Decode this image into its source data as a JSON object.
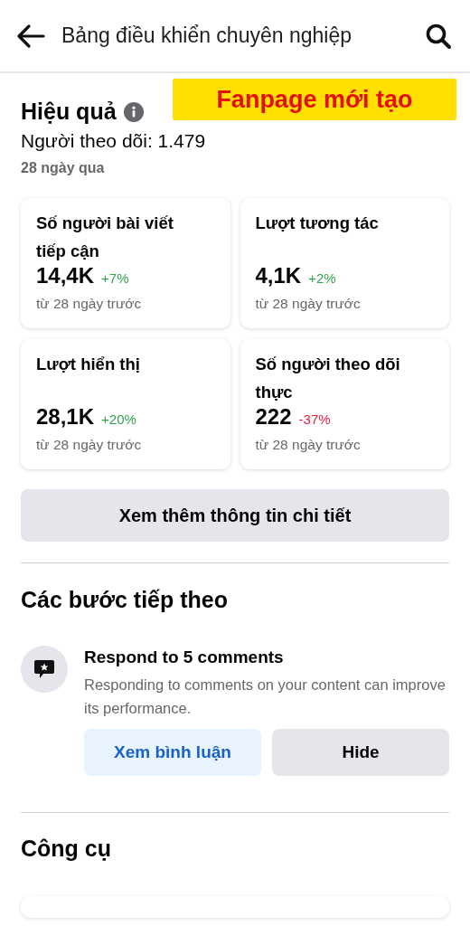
{
  "header": {
    "title": "Bảng điều khiển chuyên nghiệp"
  },
  "banner": {
    "text": "Fanpage mới tạo"
  },
  "performance": {
    "title": "Hiệu quả",
    "followers": "Người theo dõi: 1.479",
    "period": "28 ngày qua",
    "metrics": [
      {
        "label": "Số người bài viết tiếp cận",
        "value": "14,4K",
        "change": "+7%",
        "kind": "increase",
        "note": "từ 28 ngày trước"
      },
      {
        "label": "Lượt tương tác",
        "value": "4,1K",
        "change": "+2%",
        "kind": "increase",
        "note": "từ 28 ngày trước"
      },
      {
        "label": "Lượt hiển thị",
        "value": "28,1K",
        "change": "+20%",
        "kind": "increase",
        "note": "từ 28 ngày trước"
      },
      {
        "label": "Số người theo dõi thực",
        "value": "222",
        "change": "-37%",
        "kind": "decrease",
        "note": "từ 28 ngày trước"
      }
    ],
    "more_button": "Xem thêm thông tin chi tiết"
  },
  "next_steps": {
    "title": "Các bước tiếp theo",
    "task": {
      "title": "Respond to 5 comments",
      "description": "Responding to comments on your content can improve its performance.",
      "primary_button": "Xem bình luận",
      "secondary_button": "Hide"
    }
  },
  "tools": {
    "title": "Công cụ"
  }
}
